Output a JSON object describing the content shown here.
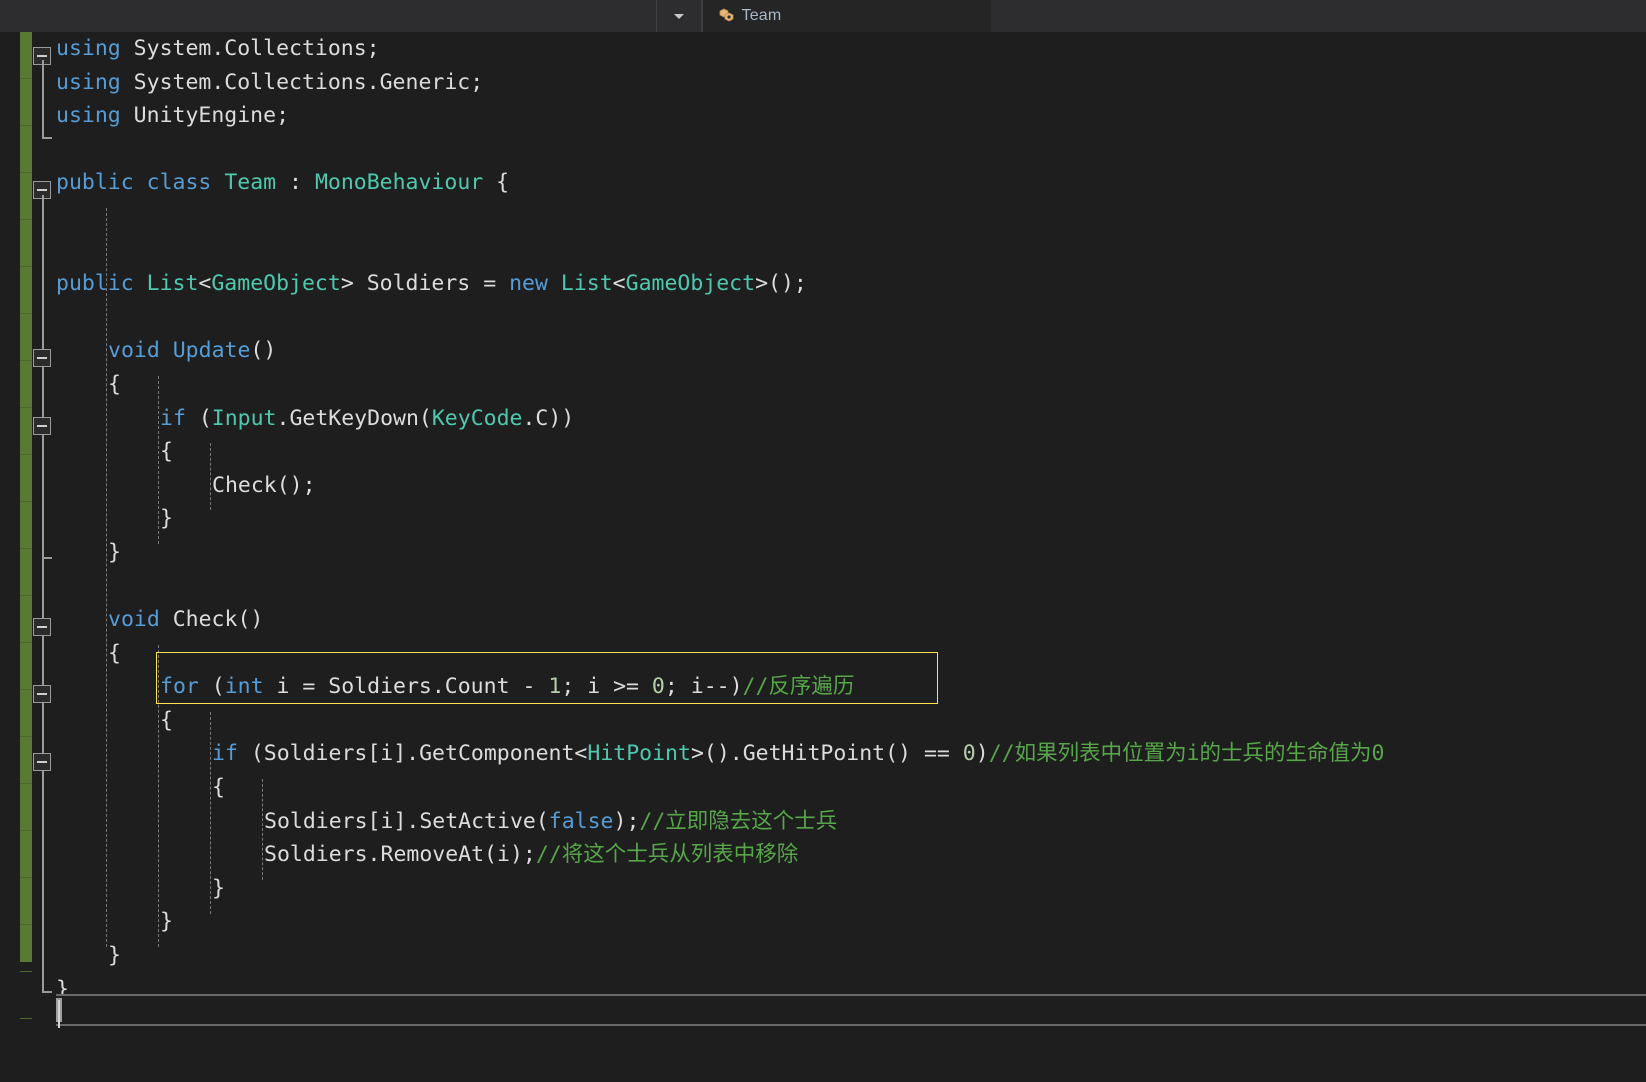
{
  "window": {
    "title": "Team",
    "theme": "visual-studio-dark",
    "background": "#1e1e1e"
  },
  "toolbar": {
    "dropdown_icon": "chevron-down-icon",
    "tab": {
      "icon": "class-icon",
      "label": "Team"
    }
  },
  "colors": {
    "keyword": "#569cd6",
    "type": "#4ec9b0",
    "comment": "#57a64a",
    "number": "#b5cea8",
    "plain": "#dcdcdc",
    "highlight_border": "#ffe14d",
    "change_bar": "#5a7a33"
  },
  "highlight": {
    "target_line": "for (int i = Soldiers.Count - 1; i >= 0; i--)//反序遍历",
    "border_color": "#ffe14d"
  },
  "code": {
    "language": "csharp",
    "lines": [
      {
        "indent": 0,
        "fold": "minus",
        "tokens": [
          {
            "text": "using",
            "cls": "k"
          },
          {
            "text": " System.Collections;",
            "cls": "id"
          }
        ]
      },
      {
        "indent": 0,
        "fold": "line",
        "tokens": [
          {
            "text": "using",
            "cls": "k"
          },
          {
            "text": " System.Collections.Generic;",
            "cls": "id"
          }
        ]
      },
      {
        "indent": 0,
        "fold": "end",
        "tokens": [
          {
            "text": "using",
            "cls": "k"
          },
          {
            "text": " UnityEngine;",
            "cls": "id"
          }
        ]
      },
      {
        "indent": 0,
        "fold": "none",
        "tokens": []
      },
      {
        "indent": 0,
        "fold": "minus",
        "tokens": [
          {
            "text": "public",
            "cls": "k"
          },
          {
            "text": " ",
            "cls": "p"
          },
          {
            "text": "class",
            "cls": "k"
          },
          {
            "text": " ",
            "cls": "p"
          },
          {
            "text": "Team",
            "cls": "t"
          },
          {
            "text": " : ",
            "cls": "p"
          },
          {
            "text": "MonoBehaviour",
            "cls": "t"
          },
          {
            "text": " {",
            "cls": "p"
          }
        ]
      },
      {
        "indent": 0,
        "fold": "line",
        "tokens": []
      },
      {
        "indent": 0,
        "fold": "line",
        "tokens": []
      },
      {
        "indent": 0,
        "fold": "line",
        "tokens": [
          {
            "text": "public",
            "cls": "k"
          },
          {
            "text": " ",
            "cls": "p"
          },
          {
            "text": "List",
            "cls": "t"
          },
          {
            "text": "<",
            "cls": "p"
          },
          {
            "text": "GameObject",
            "cls": "t"
          },
          {
            "text": "> Soldiers = ",
            "cls": "id"
          },
          {
            "text": "new",
            "cls": "k"
          },
          {
            "text": " ",
            "cls": "p"
          },
          {
            "text": "List",
            "cls": "t"
          },
          {
            "text": "<",
            "cls": "p"
          },
          {
            "text": "GameObject",
            "cls": "t"
          },
          {
            "text": ">();",
            "cls": "p"
          }
        ]
      },
      {
        "indent": 0,
        "fold": "line",
        "tokens": []
      },
      {
        "indent": 1,
        "fold": "minus",
        "tokens": [
          {
            "text": "void",
            "cls": "k"
          },
          {
            "text": " ",
            "cls": "p"
          },
          {
            "text": "Update",
            "cls": "k"
          },
          {
            "text": "()",
            "cls": "p"
          }
        ]
      },
      {
        "indent": 1,
        "fold": "line",
        "tokens": [
          {
            "text": "{",
            "cls": "p"
          }
        ]
      },
      {
        "indent": 2,
        "fold": "minus",
        "tokens": [
          {
            "text": "if",
            "cls": "k"
          },
          {
            "text": " (",
            "cls": "p"
          },
          {
            "text": "Input",
            "cls": "t"
          },
          {
            "text": ".GetKeyDown(",
            "cls": "id"
          },
          {
            "text": "KeyCode",
            "cls": "t"
          },
          {
            "text": ".C))",
            "cls": "id"
          }
        ]
      },
      {
        "indent": 2,
        "fold": "line",
        "tokens": [
          {
            "text": "{",
            "cls": "p"
          }
        ]
      },
      {
        "indent": 3,
        "fold": "line",
        "tokens": [
          {
            "text": "Check();",
            "cls": "id"
          }
        ]
      },
      {
        "indent": 2,
        "fold": "end",
        "tokens": [
          {
            "text": "}",
            "cls": "p"
          }
        ]
      },
      {
        "indent": 1,
        "fold": "end",
        "tokens": [
          {
            "text": "}",
            "cls": "p"
          }
        ]
      },
      {
        "indent": 0,
        "fold": "line",
        "tokens": []
      },
      {
        "indent": 1,
        "fold": "minus",
        "tokens": [
          {
            "text": "void",
            "cls": "k"
          },
          {
            "text": " Check()",
            "cls": "id"
          }
        ]
      },
      {
        "indent": 1,
        "fold": "line",
        "tokens": [
          {
            "text": "{",
            "cls": "p"
          }
        ]
      },
      {
        "indent": 2,
        "fold": "minus",
        "highlighted": true,
        "tokens": [
          {
            "text": "for",
            "cls": "k"
          },
          {
            "text": " (",
            "cls": "p"
          },
          {
            "text": "int",
            "cls": "k"
          },
          {
            "text": " i = Soldiers.Count - ",
            "cls": "id"
          },
          {
            "text": "1",
            "cls": "n"
          },
          {
            "text": "; i >= ",
            "cls": "id"
          },
          {
            "text": "0",
            "cls": "n"
          },
          {
            "text": "; i--)",
            "cls": "id"
          },
          {
            "text": "//反序遍历",
            "cls": "c"
          }
        ]
      },
      {
        "indent": 2,
        "fold": "line",
        "tokens": [
          {
            "text": "{",
            "cls": "p"
          }
        ]
      },
      {
        "indent": 3,
        "fold": "minus",
        "tokens": [
          {
            "text": "if",
            "cls": "k"
          },
          {
            "text": " (Soldiers[i].GetComponent<",
            "cls": "id"
          },
          {
            "text": "HitPoint",
            "cls": "t"
          },
          {
            "text": ">().GetHitPoint() == ",
            "cls": "id"
          },
          {
            "text": "0",
            "cls": "n"
          },
          {
            "text": ")",
            "cls": "p"
          },
          {
            "text": "//如果列表中位置为i的士兵的生命值为0",
            "cls": "c"
          }
        ]
      },
      {
        "indent": 3,
        "fold": "line",
        "tokens": [
          {
            "text": "{",
            "cls": "p"
          }
        ]
      },
      {
        "indent": 4,
        "fold": "line",
        "tokens": [
          {
            "text": "Soldiers[i].SetActive(",
            "cls": "id"
          },
          {
            "text": "false",
            "cls": "k"
          },
          {
            "text": ");",
            "cls": "p"
          },
          {
            "text": "//立即隐去这个士兵",
            "cls": "c"
          }
        ]
      },
      {
        "indent": 4,
        "fold": "line",
        "tokens": [
          {
            "text": "Soldiers.RemoveAt(i);",
            "cls": "id"
          },
          {
            "text": "//将这个士兵从列表中移除",
            "cls": "c"
          }
        ]
      },
      {
        "indent": 3,
        "fold": "end",
        "tokens": [
          {
            "text": "}",
            "cls": "p"
          }
        ]
      },
      {
        "indent": 2,
        "fold": "end",
        "tokens": [
          {
            "text": "}",
            "cls": "p"
          }
        ]
      },
      {
        "indent": 1,
        "fold": "end",
        "tokens": [
          {
            "text": "}",
            "cls": "p"
          }
        ]
      },
      {
        "indent": 0,
        "fold": "end",
        "tokens": [
          {
            "text": "}",
            "cls": "p"
          }
        ]
      }
    ]
  },
  "scrollbar": {
    "orientation": "horizontal",
    "thumb_position": "left"
  }
}
